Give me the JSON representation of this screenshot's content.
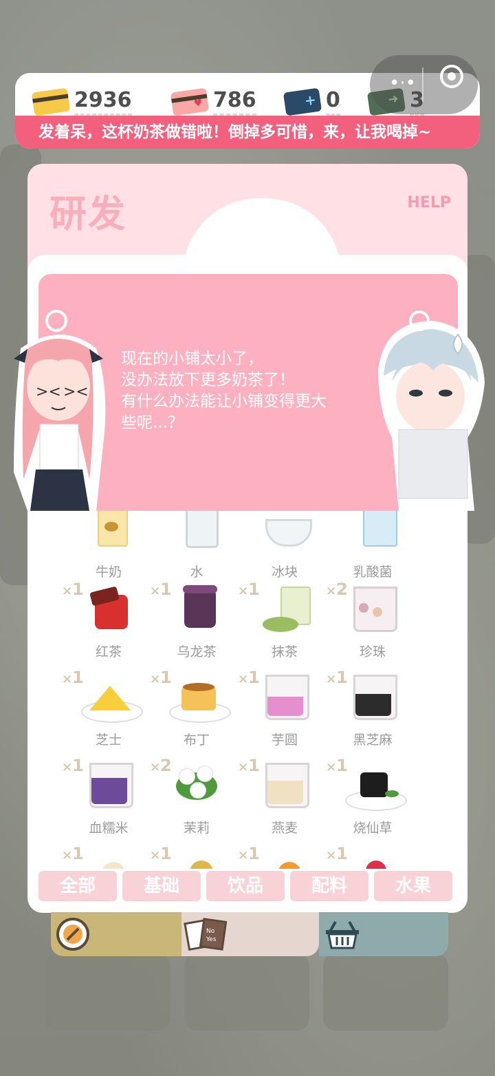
{
  "currency": {
    "gold_value": "2936",
    "pink_value": "786",
    "blue_value": "0",
    "green_value": "3"
  },
  "marquee_text": "发着呆，这杯奶茶做错啦！倒掉多可惜，来，让我喝掉~",
  "panel": {
    "title": "研发",
    "help": "HELP"
  },
  "dialog": {
    "lines": [
      "现在的小铺太小了，",
      "没办法放下更多奶茶了！",
      "有什么办法能让小铺变得更大",
      "些呢...？"
    ]
  },
  "ingredients": [
    {
      "name": "牛奶",
      "qty": ""
    },
    {
      "name": "水",
      "qty": ""
    },
    {
      "name": "冰块",
      "qty": ""
    },
    {
      "name": "乳酸菌",
      "qty": ""
    },
    {
      "name": "红茶",
      "qty": "1"
    },
    {
      "name": "乌龙茶",
      "qty": "1"
    },
    {
      "name": "抹茶",
      "qty": "1"
    },
    {
      "name": "珍珠",
      "qty": "2"
    },
    {
      "name": "芝士",
      "qty": "1"
    },
    {
      "name": "布丁",
      "qty": "1"
    },
    {
      "name": "芋圆",
      "qty": "1"
    },
    {
      "name": "黑芝麻",
      "qty": "1"
    },
    {
      "name": "血糯米",
      "qty": "1"
    },
    {
      "name": "茉莉",
      "qty": "2"
    },
    {
      "name": "燕麦",
      "qty": "1"
    },
    {
      "name": "烧仙草",
      "qty": "1"
    },
    {
      "name": "",
      "qty": "1"
    },
    {
      "name": "",
      "qty": "1"
    },
    {
      "name": "",
      "qty": "1"
    },
    {
      "name": "",
      "qty": "1"
    }
  ],
  "tabs": [
    "全部",
    "基础",
    "饮品",
    "配料",
    "水果"
  ],
  "nav": {
    "colors": {
      "left": "#c9b779",
      "middle": "#e5d7cf",
      "right": "#8eaaaa"
    },
    "icons": [
      "compass-icon",
      "recipe-cards-icon",
      "basket-icon"
    ]
  },
  "colors": {
    "accent": "#f2607e",
    "panel_pink": "#ffe0e5",
    "dialog_pink": "#fdb0c0"
  }
}
